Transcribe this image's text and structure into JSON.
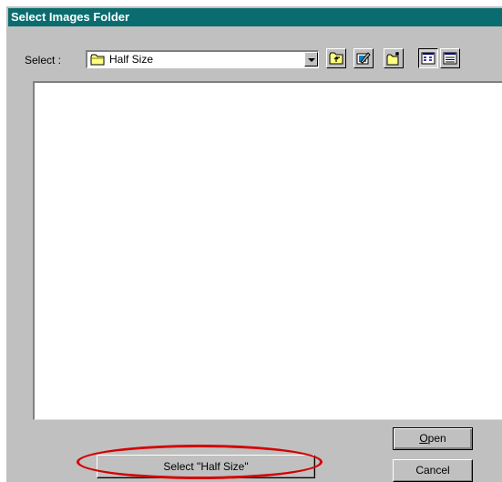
{
  "window": {
    "title": "Select Images Folder"
  },
  "toolbar": {
    "select_label": "Select :",
    "current_folder": "Half Size",
    "icons": [
      "folder-icon",
      "dropdown-arrow-icon",
      "up-one-level-icon",
      "desktop-icon",
      "new-folder-icon",
      "list-view-icon",
      "details-view-icon"
    ]
  },
  "buttons": {
    "open_label_underlined": "O",
    "open_label_rest": "pen",
    "cancel_label": "Cancel",
    "select_folder_label": "Select \"Half Size\""
  },
  "colors": {
    "titlebar": "#0a6c6e",
    "dialog_face": "#c0c0c0",
    "highlight_ellipse": "#d40000"
  }
}
